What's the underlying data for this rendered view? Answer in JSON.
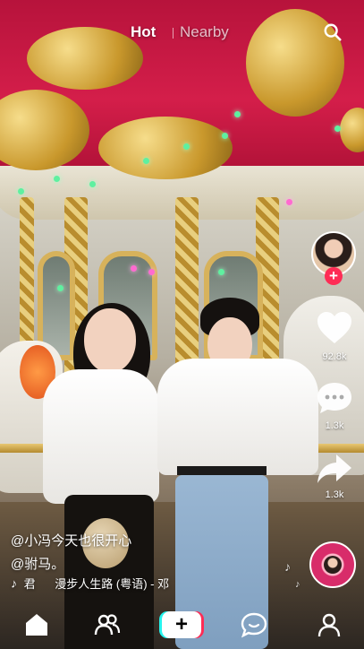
{
  "top_nav": {
    "tabs": [
      {
        "label": "Hot",
        "active": true
      },
      {
        "label": "Nearby",
        "active": false
      }
    ],
    "search_icon": "search-icon"
  },
  "video": {
    "scene": "carousel"
  },
  "right_rail": {
    "follow_label": "+",
    "likes_count": "92.8k",
    "comments_count": "1.3k",
    "shares_count": "1.3k",
    "icons": [
      "heart-icon",
      "comment-bubble-icon",
      "share-arrow-icon",
      "music-disc-icon"
    ],
    "music_note_symbol": "♪"
  },
  "caption": {
    "author": "@小冯今天也很开心",
    "mention": "@驸马。",
    "music_symbol": "♪",
    "music_artist": "君",
    "music_title": "漫步人生路 (粤语) - 邓"
  },
  "bottom_bar": {
    "items": [
      "home-icon",
      "friends-icon",
      "create-button",
      "inbox-icon",
      "profile-icon"
    ],
    "create_label": "+"
  },
  "colors": {
    "accent_red": "#fe2c55",
    "accent_cyan": "#25f4ee"
  }
}
